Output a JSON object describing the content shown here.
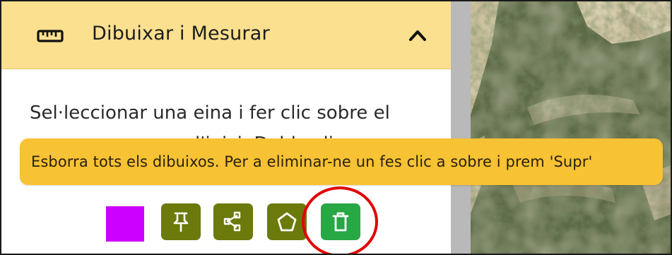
{
  "panel": {
    "title": "Dibuixar i Mesurar",
    "title_icon": "ruler-icon",
    "collapse_icon": "chevron-up-icon",
    "description_line1": "Sel·leccionar una eina i fer clic sobre el",
    "description_line2": "mapa per marcar l'inici. Doble clic per"
  },
  "tooltip": {
    "text": "Esborra tots els dibuixos. Per a eliminar-ne un fes clic a sobre i prem 'Supr'"
  },
  "toolbar": {
    "color_swatch": "#cc00ff",
    "tools": [
      {
        "name": "point",
        "icon": "pin-icon",
        "color": "#6b7a0a"
      },
      {
        "name": "line",
        "icon": "polyline-icon",
        "color": "#6b7a0a"
      },
      {
        "name": "polygon",
        "icon": "pentagon-icon",
        "color": "#6b7a0a"
      },
      {
        "name": "delete-all",
        "icon": "trash-icon",
        "color": "#28a745"
      }
    ],
    "highlight_color": "#e10000"
  },
  "colors": {
    "header_bg": "#fbe08f",
    "tooltip_bg": "#f7c233"
  }
}
